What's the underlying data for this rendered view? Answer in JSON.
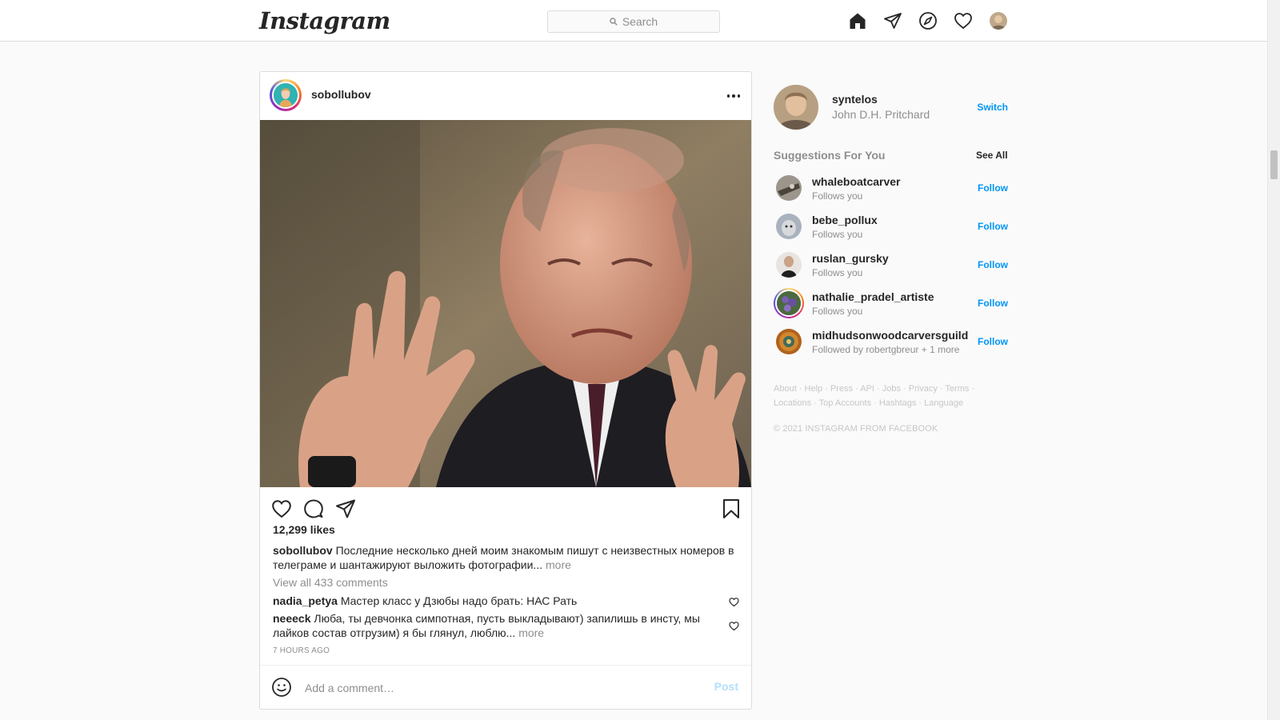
{
  "nav": {
    "logo": "Instagram",
    "search_placeholder": "Search",
    "icons": [
      "home-icon",
      "direct-icon",
      "explore-icon",
      "activity-icon",
      "profile-avatar"
    ]
  },
  "post": {
    "username": "sobollubov",
    "likes": "12,299 likes",
    "caption_user": "sobollubov",
    "caption_text": "Последние несколько дней моим знакомым пишут с неизвестных номеров в телеграме и шантажируют выложить фотографии...",
    "caption_more": "more",
    "view_all_comments": "View all 433 comments",
    "comments": [
      {
        "user": "nadia_petya",
        "text": "Мастер класс у Дзюбы надо брать: НАС Рать",
        "more": ""
      },
      {
        "user": "neeeck",
        "text": "Люба, ты девчонка симпотная, пусть выкладывают) запилишь в инсту, мы лайков состав отгрузим) я бы глянул, люблю...",
        "more": "more"
      }
    ],
    "time": "7 HOURS AGO",
    "add_comment_placeholder": "Add a comment…",
    "post_button": "Post"
  },
  "sidebar": {
    "profile": {
      "username": "syntelos",
      "full_name": "John D.H. Pritchard",
      "switch": "Switch"
    },
    "suggestions_title": "Suggestions For You",
    "see_all": "See All",
    "suggestions": [
      {
        "username": "whaleboatcarver",
        "sub": "Follows you",
        "action": "Follow"
      },
      {
        "username": "bebe_pollux",
        "sub": "Follows you",
        "action": "Follow"
      },
      {
        "username": "ruslan_gursky",
        "sub": "Follows you",
        "action": "Follow"
      },
      {
        "username": "nathalie_pradel_artiste",
        "sub": "Follows you",
        "action": "Follow"
      },
      {
        "username": "midhudsonwoodcarversguild",
        "sub": "Followed by robertgbreur + 1 more",
        "action": "Follow"
      }
    ],
    "footer_links": [
      "About",
      "Help",
      "Press",
      "API",
      "Jobs",
      "Privacy",
      "Terms",
      "Locations",
      "Top Accounts",
      "Hashtags",
      "Language"
    ],
    "copyright": "© 2021 INSTAGRAM FROM FACEBOOK"
  },
  "colors": {
    "accent_blue": "#0095f6",
    "post_disabled": "#b2dffc",
    "muted": "#8e8e8e",
    "border": "#dbdbdb"
  }
}
